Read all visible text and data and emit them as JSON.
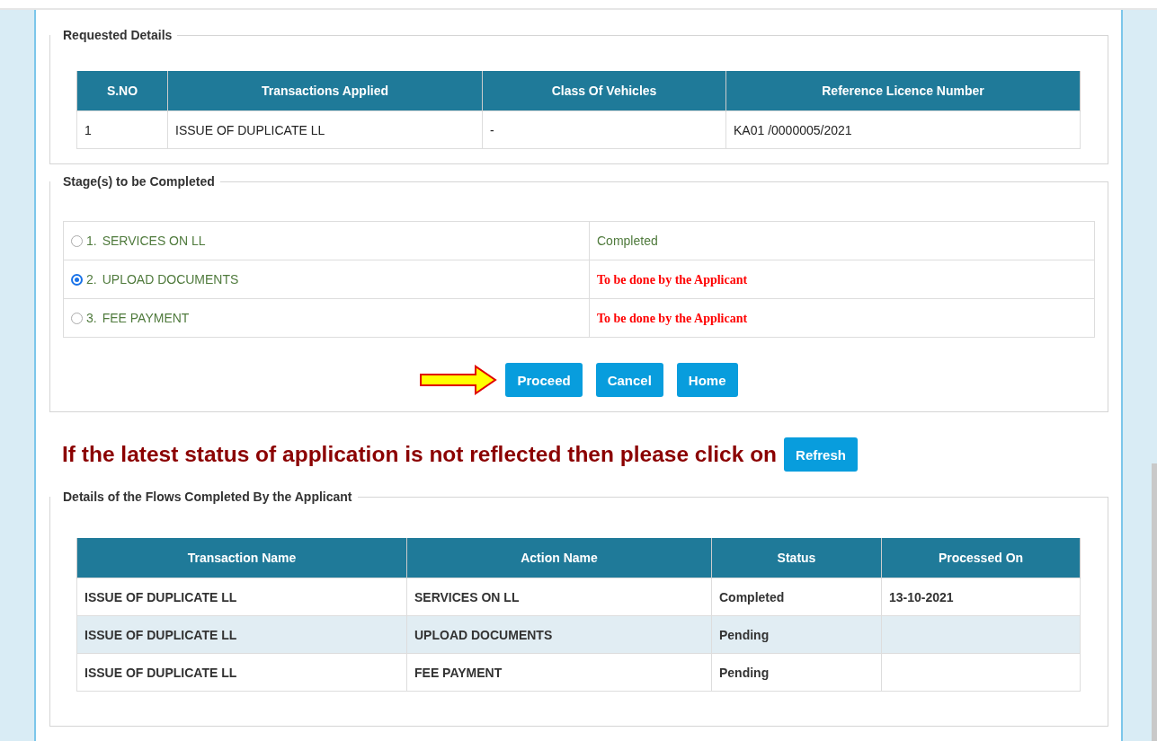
{
  "requested_details": {
    "title": "Requested Details",
    "table": {
      "columns": [
        "S.NO",
        "Transactions Applied",
        "Class Of Vehicles",
        "Reference Licence Number"
      ],
      "rows": [
        [
          "1",
          "ISSUE OF DUPLICATE LL",
          "-",
          "KA01 /0000005/2021"
        ]
      ]
    }
  },
  "stages": {
    "title": "Stage(s) to be Completed",
    "items": [
      {
        "number": "1.",
        "label": "SERVICES ON LL",
        "selected": false,
        "status": "Completed",
        "kind": "done"
      },
      {
        "number": "2.",
        "label": "UPLOAD DOCUMENTS",
        "selected": true,
        "status": "To be done by the Applicant",
        "kind": "pending"
      },
      {
        "number": "3.",
        "label": "FEE PAYMENT",
        "selected": false,
        "status": "To be done by the Applicant",
        "kind": "pending"
      }
    ],
    "buttons": [
      "Proceed",
      "Cancel",
      "Home"
    ]
  },
  "refresh_notice": {
    "text": "If the latest status of application is not reflected then please click on",
    "button": "Refresh"
  },
  "flows": {
    "title": "Details of the Flows Completed By the Applicant",
    "table": {
      "columns": [
        "Transaction Name",
        "Action Name",
        "Status",
        "Processed On"
      ],
      "rows": [
        [
          "ISSUE OF DUPLICATE LL",
          "SERVICES ON LL",
          "Completed",
          "13-10-2021"
        ],
        [
          "ISSUE OF DUPLICATE LL",
          "UPLOAD DOCUMENTS",
          "Pending",
          ""
        ],
        [
          "ISSUE OF DUPLICATE LL",
          "FEE PAYMENT",
          "Pending",
          ""
        ]
      ]
    }
  }
}
